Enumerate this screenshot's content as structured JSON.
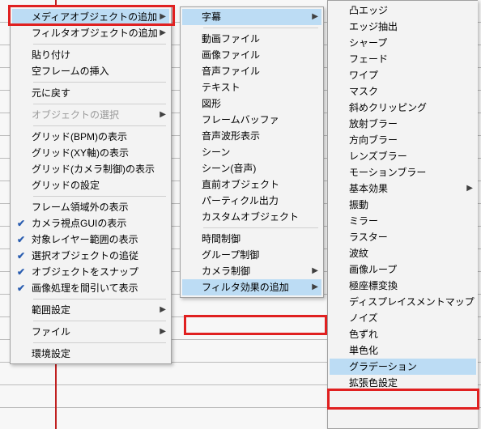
{
  "menu1": {
    "items": [
      {
        "label": "メディアオブジェクトの追加",
        "submenu": true,
        "highlight": true
      },
      {
        "label": "フィルタオブジェクトの追加",
        "submenu": true
      },
      {
        "sep": true
      },
      {
        "label": "貼り付け"
      },
      {
        "label": "空フレームの挿入"
      },
      {
        "sep": true
      },
      {
        "label": "元に戻す"
      },
      {
        "sep": true
      },
      {
        "label": "オブジェクトの選択",
        "submenu": true,
        "disabled": true
      },
      {
        "sep": true
      },
      {
        "label": "グリッド(BPM)の表示"
      },
      {
        "label": "グリッド(XY軸)の表示"
      },
      {
        "label": "グリッド(カメラ制御)の表示"
      },
      {
        "label": "グリッドの設定"
      },
      {
        "sep": true
      },
      {
        "label": "フレーム領域外の表示"
      },
      {
        "label": "カメラ視点GUIの表示",
        "checked": true
      },
      {
        "label": "対象レイヤー範囲の表示",
        "checked": true
      },
      {
        "label": "選択オブジェクトの追従",
        "checked": true
      },
      {
        "label": "オブジェクトをスナップ",
        "checked": true
      },
      {
        "label": "画像処理を間引いて表示",
        "checked": true
      },
      {
        "sep": true
      },
      {
        "label": "範囲設定",
        "submenu": true
      },
      {
        "sep": true
      },
      {
        "label": "ファイル",
        "submenu": true
      },
      {
        "sep": true
      },
      {
        "label": "環境設定"
      }
    ]
  },
  "menu2": {
    "items": [
      {
        "label": "字幕",
        "submenu": true,
        "highlight": true
      },
      {
        "sep": true
      },
      {
        "label": "動画ファイル"
      },
      {
        "label": "画像ファイル"
      },
      {
        "label": "音声ファイル"
      },
      {
        "label": "テキスト"
      },
      {
        "label": "図形"
      },
      {
        "label": "フレームバッファ"
      },
      {
        "label": "音声波形表示"
      },
      {
        "label": "シーン"
      },
      {
        "label": "シーン(音声)"
      },
      {
        "label": "直前オブジェクト"
      },
      {
        "label": "パーティクル出力"
      },
      {
        "label": "カスタムオブジェクト"
      },
      {
        "sep": true
      },
      {
        "label": "時間制御"
      },
      {
        "label": "グループ制御"
      },
      {
        "label": "カメラ制御",
        "submenu": true
      },
      {
        "label": "フィルタ効果の追加",
        "submenu": true,
        "highlight": true
      }
    ]
  },
  "menu3": {
    "items": [
      {
        "label": "凸エッジ"
      },
      {
        "label": "エッジ抽出"
      },
      {
        "label": "シャープ"
      },
      {
        "label": "フェード"
      },
      {
        "label": "ワイプ"
      },
      {
        "label": "マスク"
      },
      {
        "label": "斜めクリッピング"
      },
      {
        "label": "放射ブラー"
      },
      {
        "label": "方向ブラー"
      },
      {
        "label": "レンズブラー"
      },
      {
        "label": "モーションブラー"
      },
      {
        "label": "基本効果",
        "submenu": true
      },
      {
        "label": "振動"
      },
      {
        "label": "ミラー"
      },
      {
        "label": "ラスター"
      },
      {
        "label": "波紋"
      },
      {
        "label": "画像ループ"
      },
      {
        "label": "極座標変換"
      },
      {
        "label": "ディスプレイスメントマップ"
      },
      {
        "label": "ノイズ"
      },
      {
        "label": "色ずれ"
      },
      {
        "label": "単色化"
      },
      {
        "label": "グラデーション",
        "highlight": true
      },
      {
        "label": "拡張色設定"
      }
    ]
  }
}
